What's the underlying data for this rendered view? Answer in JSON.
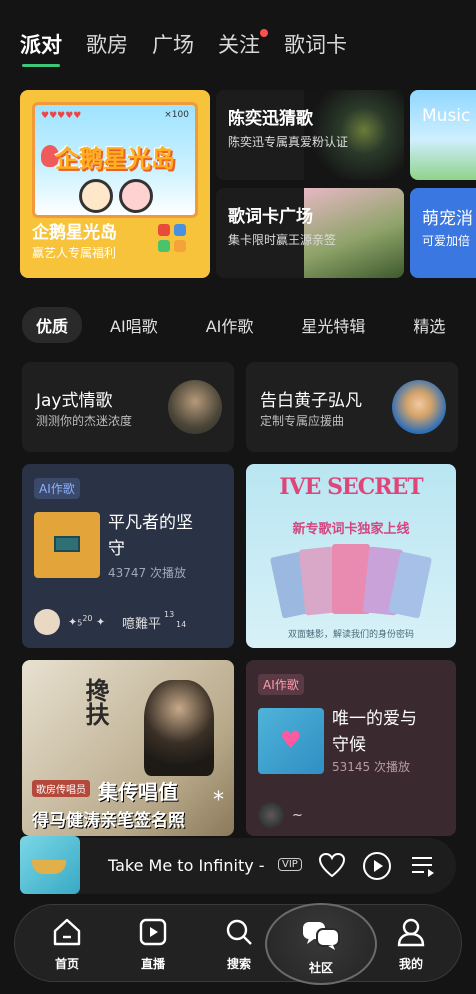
{
  "top_tabs": [
    {
      "label": "派对",
      "active": true
    },
    {
      "label": "歌房"
    },
    {
      "label": "广场"
    },
    {
      "label": "关注",
      "has_dot": true
    },
    {
      "label": "歌词卡"
    }
  ],
  "banners": {
    "main": {
      "title": "企鹅星光岛",
      "subtitle": "赢艺人专属福利",
      "art_text": "企鹅星光岛",
      "counter": "×100"
    },
    "card1": {
      "title": "陈奕迅猜歌",
      "subtitle": "陈奕迅专属真爱粉认证"
    },
    "card2": {
      "title": "歌词卡广场",
      "subtitle": "集卡限时赢王源亲签"
    },
    "card3": {
      "title": "Music",
      "subtitle": ""
    },
    "card4": {
      "title": "萌宠消",
      "subtitle": "可爱加倍"
    }
  },
  "categories": [
    "优质",
    "AI唱歌",
    "AI作歌",
    "星光特辑",
    "精选"
  ],
  "mini_cards": [
    {
      "title": "Jay式情歌",
      "subtitle": "测测你的杰迷浓度"
    },
    {
      "title": "告白黄子弘凡",
      "subtitle": "定制专属应援曲"
    }
  ],
  "feed": {
    "card1": {
      "badge": "AI作歌",
      "title_line1": "平凡者的坚",
      "title_line2": "守",
      "plays": "43747 次播放",
      "user_badge1": "5",
      "user_badge2": "20",
      "username": "噫難平",
      "user_sup": "13",
      "user_sub": "14"
    },
    "card2": {
      "headline": "IVE SECRET",
      "subline": "新专歌词卡独家上线",
      "footer": "双面魅影，解读我们的身份密码"
    },
    "card3": {
      "art_title": "搀扶",
      "tag": "歌房传唱员",
      "line1": "集传唱值",
      "line2": "得马健涛亲笔签名照"
    },
    "card4": {
      "badge": "AI作歌",
      "title_line1": "唯一的爱与",
      "title_line2": "守候",
      "plays": "53145 次播放",
      "username": "~"
    }
  },
  "player": {
    "title": "Take Me to Infinity -",
    "vip": "VIP"
  },
  "nav": [
    {
      "label": "首页",
      "icon": "home-icon"
    },
    {
      "label": "直播",
      "icon": "live-icon"
    },
    {
      "label": "搜索",
      "icon": "search-icon"
    },
    {
      "label": "社区",
      "icon": "community-icon",
      "active": true
    },
    {
      "label": "我的",
      "icon": "profile-icon"
    }
  ],
  "colors": {
    "accent": "#3fc67a",
    "background": "#141414",
    "dot": "#ff4e4e"
  }
}
